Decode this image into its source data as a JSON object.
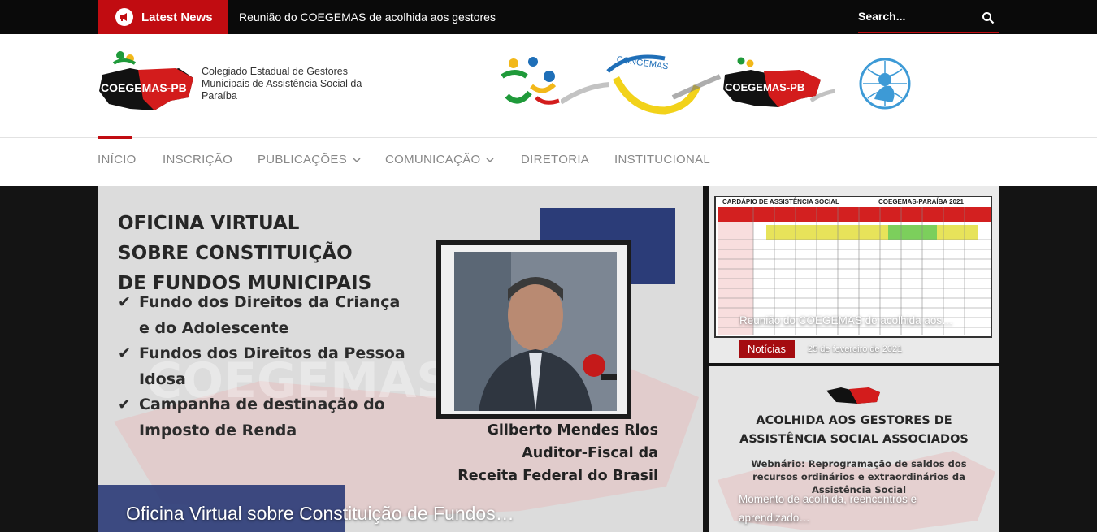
{
  "topbar": {
    "latest_label": "Latest News",
    "ticker_text": "Reunião do COEGEMAS de acolhida aos gestores",
    "search_placeholder": "Search..."
  },
  "header": {
    "logo_text": "COEGEMAS-PB",
    "org_name": "Colegiado Estadual de Gestores Municipais de Assistência Social da Paraíba",
    "partner_logos": [
      "congemas-people-icon",
      "congemas-logo",
      "coegemas-pb-logo",
      "unicef-logo"
    ],
    "congemas_label": "CONGEMAS"
  },
  "nav": {
    "items": [
      {
        "label": "INÍCIO"
      },
      {
        "label": "INSCRIÇÃO"
      },
      {
        "label": "PUBLICAÇÕES"
      },
      {
        "label": "COMUNICAÇÃO"
      },
      {
        "label": "DIRETORIA"
      },
      {
        "label": "INSTITUCIONAL"
      }
    ]
  },
  "hero": {
    "main": {
      "poster_title_1": "OFICINA VIRTUAL",
      "poster_title_2": "SOBRE CONSTITUIÇÃO",
      "poster_title_3": "DE FUNDOS MUNICIPAIS",
      "list_1a": "Fundo dos Direitos da Criança",
      "list_1b": "e do Adolescente",
      "list_2a": "Fundos dos Direitos da Pessoa",
      "list_2b": "Idosa",
      "list_3a": "Campanha de destinação do",
      "list_3b": "Imposto de Renda",
      "person_name": "Gilberto Mendes Rios",
      "person_role_1": "Auditor-Fiscal da",
      "person_role_2": "Receita Federal do Brasil",
      "caption": "Oficina Virtual sobre Constituição de Fundos…"
    },
    "side_top": {
      "table_title": "CARDÁPIO DE ASSISTÊNCIA SOCIAL",
      "table_title_right": "COEGEMAS-PARAÍBA 2021",
      "caption": "Reunião do COEGEMAS de acolhida aos…",
      "category": "Notícias",
      "date": "25 de fevereiro de 2021"
    },
    "side_bottom": {
      "heading_1": "ACOLHIDA AOS GESTORES DE",
      "heading_2": "ASSISTÊNCIA SOCIAL ASSOCIADOS",
      "sub": "Webnário: Reprogramação de saldos dos recursos ordinários e extraordinários da Assistência Social",
      "caption_1": "Momento de acolhida, reencontros e",
      "caption_2": "aprendizado…"
    }
  },
  "colors": {
    "brand_red": "#c10c11",
    "topbar_bg": "#0a0a0a",
    "nav_text": "#888888",
    "navy": "#2b3c78"
  }
}
